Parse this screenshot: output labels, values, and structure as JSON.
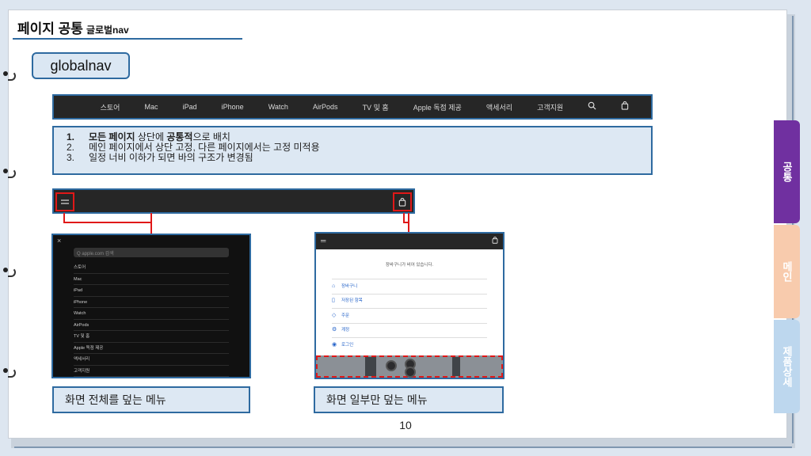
{
  "page": {
    "title_main": "페이지 공통",
    "title_sub": "글로벌nav",
    "tag": "globalnav",
    "page_number": "10"
  },
  "globalnav": {
    "items": [
      "스토어",
      "Mac",
      "iPad",
      "iPhone",
      "Watch",
      "AirPods",
      "TV 및 홈",
      "Apple 독점 제공",
      "액세서리",
      "고객지원"
    ],
    "logo_icon": "apple-logo-icon",
    "search_icon": "search-icon",
    "bag_icon": "bag-icon"
  },
  "notes": [
    {
      "num": "1.",
      "bold1": "모든 페이지",
      "t1": " 상단에 ",
      "bold2": "공통적",
      "t2": "으로 배치"
    },
    {
      "num": "2.",
      "text": "메인 페이지에서 상단 고정, 다른 페이지에서는 고정 미적용"
    },
    {
      "num": "3.",
      "text": "일정 너비 이하가 되면 바의 구조가 변경됨"
    }
  ],
  "full_menu": {
    "close": "×",
    "search_placeholder": "Q  apple.com 검색",
    "items": [
      "스토어",
      "Mac",
      "iPad",
      "iPhone",
      "Watch",
      "AirPods",
      "TV 및 홈",
      "Apple 독점 제공",
      "액세서리",
      "고객지원"
    ]
  },
  "bag_menu": {
    "empty_message": "장바구니가 비어 있습니다.",
    "items": [
      {
        "icon": "bag-icon",
        "glyph": "⌂",
        "label": "장바구니"
      },
      {
        "icon": "bookmark-icon",
        "glyph": "▯",
        "label": "저장된 항목"
      },
      {
        "icon": "box-icon",
        "glyph": "◇",
        "label": "주문"
      },
      {
        "icon": "gear-icon",
        "glyph": "⚙",
        "label": "계정"
      },
      {
        "icon": "person-icon",
        "glyph": "◉",
        "label": "로그인"
      }
    ]
  },
  "captions": {
    "full": "화면 전체를 덮는 메뉴",
    "partial": "화면 일부만 덮는 메뉴"
  },
  "side_tabs": [
    {
      "label": "공통",
      "color": "#7030a0"
    },
    {
      "label": "메인",
      "color": "#f8cbad"
    },
    {
      "label": "제품상세",
      "color": "#bdd7ee"
    }
  ],
  "colors": {
    "accent_blue": "#2e6aa0",
    "highlight_red": "#e01818",
    "nav_dark": "#262626"
  }
}
